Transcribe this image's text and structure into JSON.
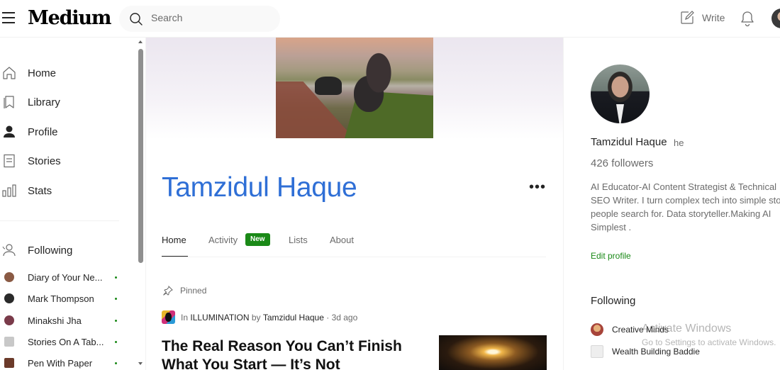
{
  "header": {
    "logo": "Medium",
    "search_placeholder": "Search",
    "write_label": "Write"
  },
  "sidebar": {
    "nav": [
      {
        "label": "Home",
        "icon": "home-icon"
      },
      {
        "label": "Library",
        "icon": "bookmark-icon"
      },
      {
        "label": "Profile",
        "icon": "profile-icon"
      },
      {
        "label": "Stories",
        "icon": "stories-icon"
      },
      {
        "label": "Stats",
        "icon": "stats-icon"
      }
    ],
    "following_label": "Following",
    "following": [
      {
        "name": "Diary of Your Ne...",
        "avatar_color": "#8a5a44"
      },
      {
        "name": "Mark Thompson",
        "avatar_color": "#2a2a2a"
      },
      {
        "name": "Minakshi Jha",
        "avatar_color": "#7a3b4a"
      },
      {
        "name": "Stories On A Tab...",
        "avatar_color": "#c8c8c8"
      },
      {
        "name": "Pen With Paper",
        "avatar_color": "#6b3a2a"
      }
    ]
  },
  "profile": {
    "name": "Tamzidul Haque",
    "more_label": "•••",
    "tabs": [
      {
        "label": "Home",
        "active": true
      },
      {
        "label": "Activity",
        "badge": "New"
      },
      {
        "label": "Lists"
      },
      {
        "label": "About"
      }
    ]
  },
  "feed": {
    "pinned_label": "Pinned",
    "byline": {
      "in_label": "In",
      "publication": "ILLUMINATION",
      "by_label": "by",
      "author": "Tamzidul Haque",
      "time": "· 3d ago"
    },
    "article_title": "The Real Reason You Can’t Finish What You Start — It’s Not"
  },
  "right_panel": {
    "name": "Tamzidul Haque",
    "pronoun": "he",
    "followers": "426 followers",
    "bio": "AI Educator-AI Content Strategist & Technical SEO Writer. I turn complex tech into simple stories people search for. Data storyteller.Making AI Simplest .",
    "edit_profile": "Edit profile",
    "following_heading": "Following",
    "following": [
      {
        "name": "Creative Minds"
      },
      {
        "name": "Wealth Building Baddie"
      }
    ]
  },
  "watermark": {
    "line1": "Activate Windows",
    "line2": "Go to Settings to activate Windows."
  },
  "colors": {
    "accent_green": "#1a8917",
    "name_blue": "#2f6fd6",
    "text_dark": "#242424",
    "text_muted": "#6b6b6b"
  }
}
